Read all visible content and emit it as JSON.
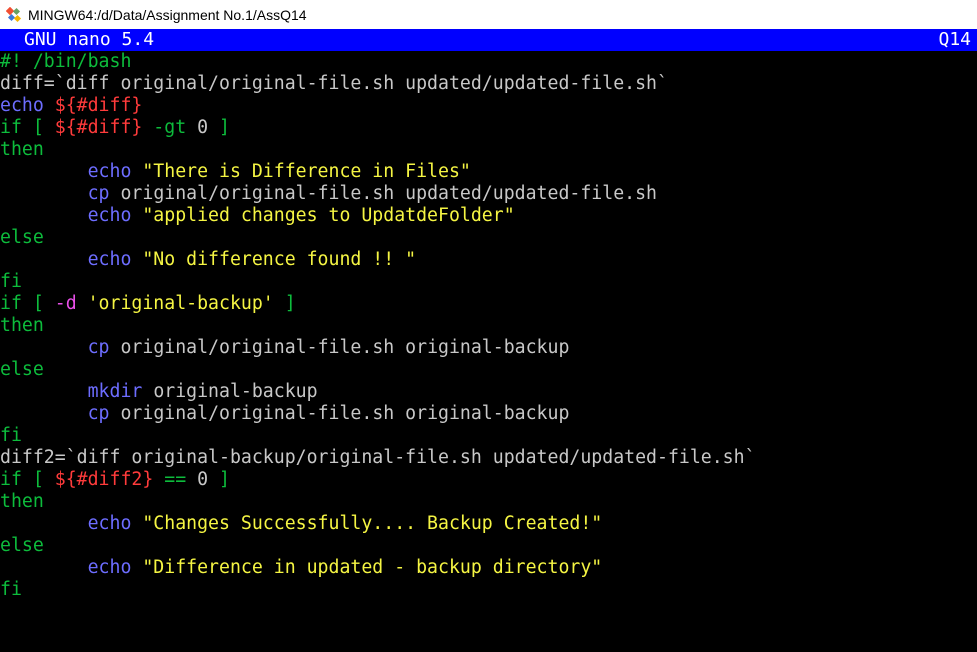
{
  "window": {
    "title": "MINGW64:/d/Data/Assignment No.1/AssQ14"
  },
  "nano": {
    "version": "GNU nano 5.4",
    "filename": "Q14"
  },
  "colors": {
    "default": "#c8c8c8",
    "keyword": "#0dbc3c",
    "builtin": "#6d6dff",
    "variable": "#ff3b3b",
    "string": "#f5f543",
    "flag": "#e84fe8",
    "header_bg": "#0000ff"
  },
  "lines": [
    [
      {
        "t": "#! /bin/bash",
        "c": "keyword"
      }
    ],
    [
      {
        "t": "diff=`diff original/original-file.sh updated/updated-file.sh`",
        "c": "default"
      }
    ],
    [
      {
        "t": "echo ",
        "c": "builtin"
      },
      {
        "t": "${#diff}",
        "c": "variable"
      }
    ],
    [
      {
        "t": "if [ ",
        "c": "keyword"
      },
      {
        "t": "${#diff}",
        "c": "variable"
      },
      {
        "t": " -gt ",
        "c": "keyword"
      },
      {
        "t": "0",
        "c": "default"
      },
      {
        "t": " ]",
        "c": "keyword"
      }
    ],
    [
      {
        "t": "then",
        "c": "keyword"
      }
    ],
    [
      {
        "t": "        ",
        "c": "default"
      },
      {
        "t": "echo ",
        "c": "builtin"
      },
      {
        "t": "\"There is Difference in Files\"",
        "c": "string"
      }
    ],
    [
      {
        "t": "        ",
        "c": "default"
      },
      {
        "t": "cp ",
        "c": "builtin"
      },
      {
        "t": "original/original-file.sh updated/updated-file.sh",
        "c": "default"
      }
    ],
    [
      {
        "t": "        ",
        "c": "default"
      },
      {
        "t": "echo ",
        "c": "builtin"
      },
      {
        "t": "\"applied changes to UpdatdeFolder\"",
        "c": "string"
      }
    ],
    [
      {
        "t": "else",
        "c": "keyword"
      }
    ],
    [
      {
        "t": "        ",
        "c": "default"
      },
      {
        "t": "echo ",
        "c": "builtin"
      },
      {
        "t": "\"No difference found !! \"",
        "c": "string"
      }
    ],
    [
      {
        "t": "fi",
        "c": "keyword"
      }
    ],
    [
      {
        "t": "if [ ",
        "c": "keyword"
      },
      {
        "t": "-d ",
        "c": "flag"
      },
      {
        "t": "'original-backup'",
        "c": "string"
      },
      {
        "t": " ]",
        "c": "keyword"
      }
    ],
    [
      {
        "t": "then",
        "c": "keyword"
      }
    ],
    [
      {
        "t": "        ",
        "c": "default"
      },
      {
        "t": "cp ",
        "c": "builtin"
      },
      {
        "t": "original/original-file.sh original-backup",
        "c": "default"
      }
    ],
    [
      {
        "t": "else",
        "c": "keyword"
      }
    ],
    [
      {
        "t": "        ",
        "c": "default"
      },
      {
        "t": "mkdir ",
        "c": "builtin"
      },
      {
        "t": "original-backup",
        "c": "default"
      }
    ],
    [
      {
        "t": "        ",
        "c": "default"
      },
      {
        "t": "cp ",
        "c": "builtin"
      },
      {
        "t": "original/original-file.sh original-backup",
        "c": "default"
      }
    ],
    [
      {
        "t": "fi",
        "c": "keyword"
      }
    ],
    [
      {
        "t": "diff2=`diff original-backup/original-file.sh updated/updated-file.sh`",
        "c": "default"
      }
    ],
    [
      {
        "t": "if [ ",
        "c": "keyword"
      },
      {
        "t": "${#diff2}",
        "c": "variable"
      },
      {
        "t": " == ",
        "c": "keyword"
      },
      {
        "t": "0",
        "c": "default"
      },
      {
        "t": " ]",
        "c": "keyword"
      }
    ],
    [
      {
        "t": "then",
        "c": "keyword"
      }
    ],
    [
      {
        "t": "        ",
        "c": "default"
      },
      {
        "t": "echo ",
        "c": "builtin"
      },
      {
        "t": "\"Changes Successfully.... Backup Created!\"",
        "c": "string"
      }
    ],
    [
      {
        "t": "else",
        "c": "keyword"
      }
    ],
    [
      {
        "t": "        ",
        "c": "default"
      },
      {
        "t": "echo ",
        "c": "builtin"
      },
      {
        "t": "\"Difference in updated - backup directory\"",
        "c": "string"
      }
    ],
    [
      {
        "t": "fi",
        "c": "keyword"
      }
    ]
  ]
}
